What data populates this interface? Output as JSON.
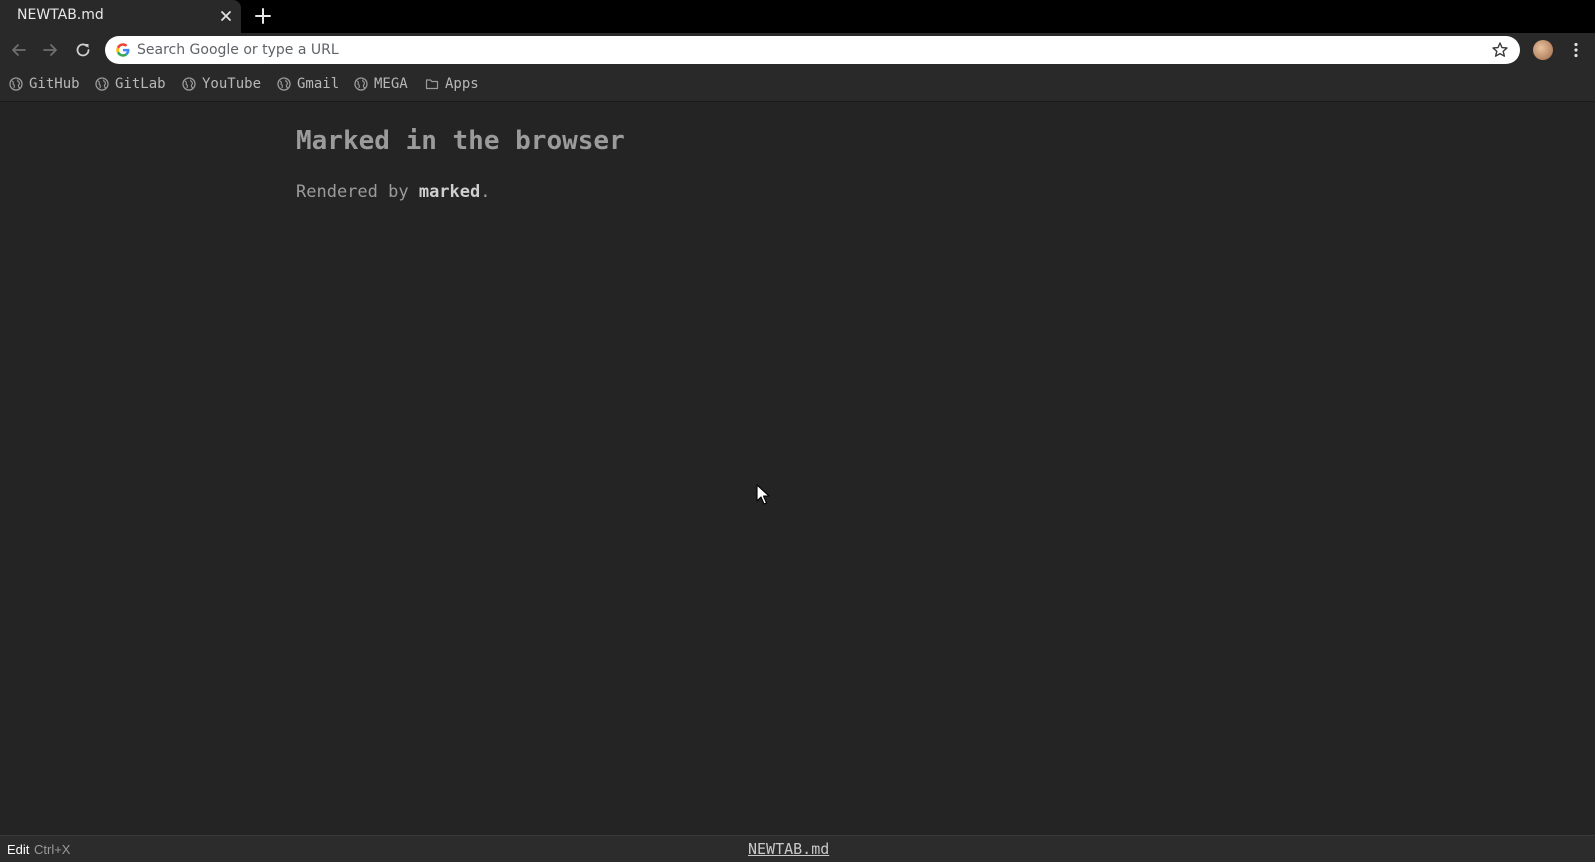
{
  "browser": {
    "tab_title": "NEWTAB.md",
    "omnibox_placeholder": "Search Google or type a URL",
    "bookmarks": [
      {
        "label": "GitHub",
        "icon": "globe-icon"
      },
      {
        "label": "GitLab",
        "icon": "globe-icon"
      },
      {
        "label": "YouTube",
        "icon": "globe-icon"
      },
      {
        "label": "Gmail",
        "icon": "globe-icon"
      },
      {
        "label": "MEGA",
        "icon": "globe-icon"
      },
      {
        "label": "Apps",
        "icon": "folder-icon"
      }
    ]
  },
  "page": {
    "heading": "Marked in the browser",
    "paragraph_prefix": "Rendered by ",
    "paragraph_strong": "marked",
    "paragraph_suffix": "."
  },
  "statusbar": {
    "edit_label": "Edit",
    "edit_shortcut": "Ctrl+X",
    "file_link": "NEWTAB.md"
  },
  "colors": {
    "background": "#242424",
    "chrome": "#292929",
    "text": "#9b9b9b"
  }
}
